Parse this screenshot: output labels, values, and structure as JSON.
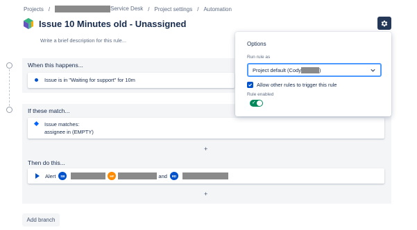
{
  "breadcrumb": {
    "projects": "Projects",
    "service_desk_suffix": "Service Desk",
    "project_settings": "Project settings",
    "automation": "Automation",
    "separator": "/"
  },
  "header": {
    "title": "Issue 10 Minutes old - Unassigned",
    "description_placeholder": "Write a brief description for this rule..."
  },
  "icons": {
    "gear": "gear-icon",
    "logo": "automation-logo-icon"
  },
  "when": {
    "heading": "When this happens...",
    "trigger": "Issue is in \"Waiting for support\" for 10m"
  },
  "if": {
    "heading": "If these match...",
    "condition_line1": "Issue matches:",
    "condition_line2": "assignee in (EMPTY)",
    "add_label": "+"
  },
  "then": {
    "heading": "Then do this...",
    "action": "Alert",
    "conjunction": "and",
    "avatars": [
      {
        "initials": "SB",
        "color": "#0052cc"
      },
      {
        "initials": "HF",
        "color": "#ff8b00"
      },
      {
        "initials": "RD",
        "color": "#0052cc"
      }
    ],
    "add_label": "+"
  },
  "add_branch": "Add branch",
  "options": {
    "title": "Options",
    "run_rule_as_label": "Run rule as",
    "run_rule_as_value": "Project default (Cody",
    "run_rule_as_close": ")",
    "allow_other_rules": "Allow other rules to trigger this rule",
    "allow_other_rules_checked": true,
    "rule_enabled_label": "Rule enabled",
    "rule_enabled": true
  },
  "colors": {
    "primary": "#0052cc",
    "toggle_on": "#00875a",
    "gear_button_bg": "#253858",
    "section_bg": "#f4f5f7"
  }
}
